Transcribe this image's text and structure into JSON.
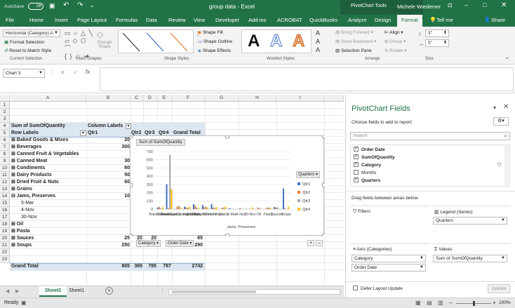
{
  "titlebar": {
    "autosave": "AutoSave",
    "autosave_state": "Off",
    "doc_title": "group data - Excel",
    "context_tools": "PivotChart Tools",
    "user": "Michele Wiedemer"
  },
  "tabs": [
    "File",
    "Home",
    "Insert",
    "Page Layout",
    "Formulas",
    "Data",
    "Review",
    "View",
    "Developer",
    "Add-ins",
    "ACROBAT",
    "QuickBooks",
    "Analyze",
    "Design",
    "Format"
  ],
  "tell_me": "Tell me",
  "share": "Share",
  "ribbon": {
    "selection_dropdown": "Horizontal (Category) A",
    "format_selection": "Format Selection",
    "reset_style": "Reset to Match Style",
    "group_current_selection": "Current Selection",
    "change_shape": "Change Shape",
    "group_insert_shapes": "Insert Shapes",
    "shape_fill": "Shape Fill",
    "shape_outline": "Shape Outline",
    "shape_effects": "Shape Effects",
    "group_shape_styles": "Shape Styles",
    "wordart_glyph": "A",
    "group_wordart": "WordArt Styles",
    "bring_forward": "Bring Forward",
    "send_backward": "Send Backward",
    "selection_pane": "Selection Pane",
    "align": "Align",
    "group": "Group",
    "rotate": "Rotate",
    "group_arrange": "Arrange",
    "height_val": "3\"",
    "width_val": "5\"",
    "group_size": "Size"
  },
  "formula_bar": {
    "name_box": "Chart 3",
    "fx": "fx"
  },
  "columns": [
    "A",
    "B",
    "C",
    "D",
    "E",
    "F",
    "G",
    "H",
    "I"
  ],
  "rows": [
    "1",
    "2",
    "3",
    "4",
    "5",
    "6",
    "7",
    "8",
    "9",
    "10",
    "11",
    "12",
    "13",
    "14",
    "15",
    "16",
    "17",
    "18",
    "19",
    "20",
    "21",
    "22",
    "23"
  ],
  "pivot": {
    "header1": [
      "Sum of SumOfQuantity",
      "Column Labels"
    ],
    "header2": [
      "Row Labels",
      "Qtr1",
      "Qtr2",
      "Qtr3",
      "Qtr4",
      "Grand Total"
    ],
    "rows": [
      {
        "label": "⊞ Baked Goods & Mixes",
        "qtr1": "20",
        "bold": true
      },
      {
        "label": "⊞ Beverages",
        "qtr1": "300",
        "bold": true
      },
      {
        "label": "⊞ Canned Fruit & Vegetables",
        "qtr1": "",
        "bold": true
      },
      {
        "label": "⊞ Canned Meat",
        "qtr1": "30",
        "bold": true
      },
      {
        "label": "⊞ Condiments",
        "qtr1": "60",
        "bold": true
      },
      {
        "label": "⊞ Dairy Products",
        "qtr1": "50",
        "bold": true
      },
      {
        "label": "⊞ Dried Fruit & Nuts",
        "qtr1": "60",
        "bold": true
      },
      {
        "label": "⊞ Grains",
        "qtr1": "",
        "bold": true
      },
      {
        "label": "⊟ Jams, Preserves",
        "qtr1": "10",
        "bold": true
      },
      {
        "label": "5-Mar",
        "qtr1": "",
        "bold": false
      },
      {
        "label": "4-Nov",
        "qtr1": "",
        "bold": false
      },
      {
        "label": "30-Nov",
        "qtr1": "",
        "bold": false
      },
      {
        "label": "⊞ Oil",
        "qtr1": "",
        "bold": true
      },
      {
        "label": "⊞ Pasta",
        "qtr1": "",
        "bold": true
      },
      {
        "label": "⊞ Sauces",
        "qtr1": "25",
        "qtr2": "20",
        "qtr3": "20",
        "total": "65",
        "bold": true
      },
      {
        "label": "⊞ Soups",
        "qtr1": "250",
        "qtr2": "10",
        "qtr4": "30",
        "total": "290",
        "bold": true
      }
    ],
    "grand_total": {
      "label": "Grand Total",
      "qtr1": "805",
      "qtr2": "365",
      "qtr3": "785",
      "qtr4": "787",
      "total": "2742"
    }
  },
  "chart_data": {
    "type": "bar",
    "title_button": "Sum of SumOfQuantity",
    "ylim": [
      0,
      700
    ],
    "yticks": [
      "700",
      "600",
      "500",
      "400",
      "300",
      "200",
      "100",
      "0"
    ],
    "categories": [
      "Baked Goods & Mixes",
      "Beverages",
      "Canned Fruit & Vegetables",
      "Canned Meat",
      "Condiments",
      "Dairy Products",
      "Dried Fruit & Nuts",
      "Grains",
      "5-Mar",
      "4-Nov",
      "30-Nov",
      "Oil",
      "Pasta",
      "Sauces",
      "Soups"
    ],
    "xlabels_display": [
      "Baked Goods",
      "Beverages",
      "Canned Fruit & Vegetables",
      "Canned Meat",
      "Condiments",
      "Dairy Products",
      "Dried Fruit",
      "Grains",
      "5-Mar",
      "4-Nov",
      "30-Nov",
      "Oil",
      "Pasta",
      "Sauces",
      "Soups"
    ],
    "group_label": "Jams, Preserves",
    "series": [
      {
        "name": "Qtr1",
        "color": "#4472c4",
        "values": [
          20,
          300,
          0,
          30,
          60,
          50,
          60,
          0,
          10,
          0,
          0,
          0,
          0,
          25,
          250
        ]
      },
      {
        "name": "Qtr2",
        "color": "#ed7d31",
        "values": [
          25,
          10,
          30,
          20,
          40,
          25,
          20,
          15,
          0,
          15,
          0,
          20,
          15,
          20,
          10
        ]
      },
      {
        "name": "Qtr3",
        "color": "#a5a5a5",
        "values": [
          10,
          660,
          40,
          15,
          20,
          30,
          15,
          20,
          0,
          0,
          0,
          10,
          20,
          20,
          0
        ]
      },
      {
        "name": "Qtr4",
        "color": "#ffc000",
        "values": [
          25,
          240,
          20,
          30,
          10,
          20,
          25,
          30,
          0,
          0,
          20,
          0,
          15,
          0,
          30
        ]
      }
    ],
    "legend_title": "Quarters",
    "axis_buttons": [
      "Category",
      "Order Date"
    ]
  },
  "pane": {
    "title": "PivotChart Fields",
    "choose": "Choose fields to add to report:",
    "search_placeholder": "Search",
    "fields": [
      {
        "name": "Order Date",
        "checked": true
      },
      {
        "name": "SumOfQuantity",
        "checked": true
      },
      {
        "name": "Category",
        "checked": true
      },
      {
        "name": "Months",
        "checked": false
      },
      {
        "name": "Quarters",
        "checked": true
      }
    ],
    "drag_hint": "Drag fields between areas below:",
    "filters": "Filters",
    "legend": "Legend (Series)",
    "legend_item": "Quarters",
    "axis": "Axis (Categories)",
    "axis_items": [
      "Category",
      "Order Date"
    ],
    "values": "Values",
    "values_item": "Sum of SumOfQuantity",
    "defer": "Defer Layout Update",
    "update": "Update"
  },
  "sheets": [
    "Sheet3",
    "Sheet1"
  ],
  "status": {
    "ready": "Ready",
    "zoom": "100%"
  }
}
